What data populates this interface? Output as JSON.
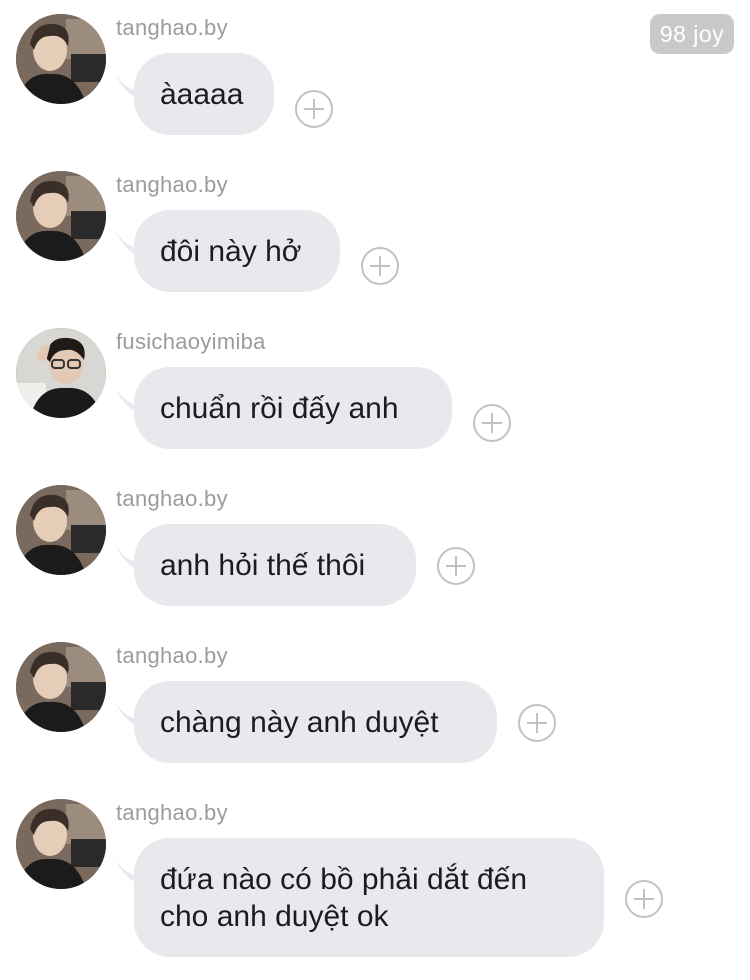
{
  "watermark": "98 joy",
  "messages": [
    {
      "sender": "tanghao.by",
      "avatar": "avatar-tanghao",
      "text": "àaaaa"
    },
    {
      "sender": "tanghao.by",
      "avatar": "avatar-tanghao",
      "text": "đôi này hở"
    },
    {
      "sender": "fusichaoyimiba",
      "avatar": "avatar-fusichaoyimiba",
      "text": "chuẩn rồi đấy anh"
    },
    {
      "sender": "tanghao.by",
      "avatar": "avatar-tanghao",
      "text": "anh hỏi thế thôi"
    },
    {
      "sender": "tanghao.by",
      "avatar": "avatar-tanghao",
      "text": "chàng này anh duyệt"
    },
    {
      "sender": "tanghao.by",
      "avatar": "avatar-tanghao",
      "text": "đứa nào có bồ phải dắt đến\ncho anh duyệt ok"
    }
  ]
}
